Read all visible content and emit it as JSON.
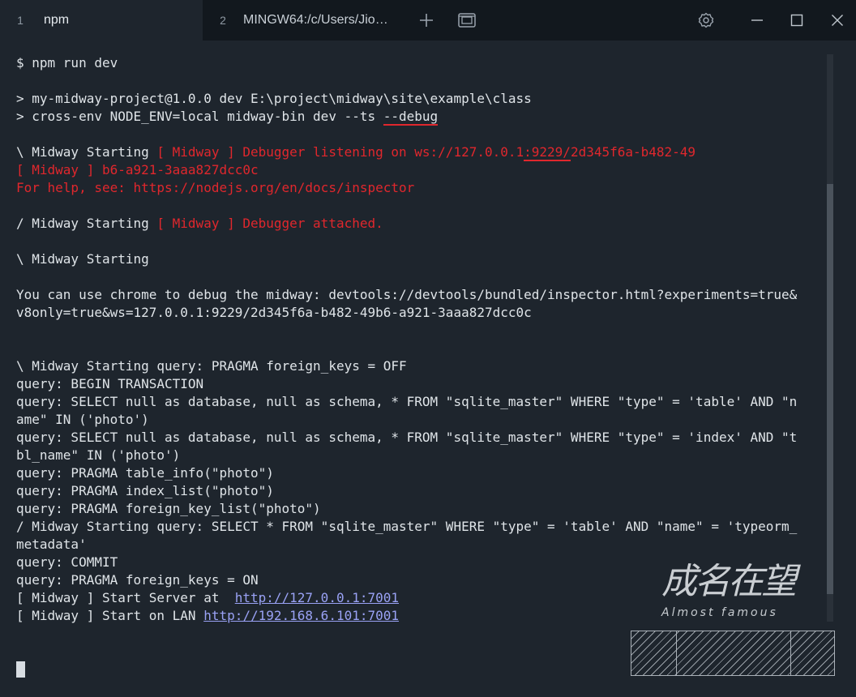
{
  "tabs": [
    {
      "num": "1",
      "label": "npm"
    },
    {
      "num": "2",
      "label": "MINGW64:/c/Users/Jio…"
    }
  ],
  "icons": {
    "add_tab": "plus-icon",
    "panes": "panes-icon",
    "settings": "gear-icon",
    "minimize": "minimize-icon",
    "maximize": "maximize-icon",
    "close": "close-icon"
  },
  "colors": {
    "error": "#e0272d",
    "link": "#9aa2f5",
    "text": "#dfe4e8",
    "background": "#1e252d"
  },
  "terminal": {
    "l0": "$ npm run dev",
    "l2": "> my-midway-project@1.0.0 dev E:\\project\\midway\\site\\example\\class",
    "l3a": "> cross-env NODE_ENV=local midway-bin dev --ts ",
    "l3b": "--debug",
    "l5a": "\\ Midway Starting ",
    "l5b": "[ Midway ] Debugger listening on ws://127.0.0.1",
    "l5c": ":9229/",
    "l5d": "2d345f6a-b482-49",
    "l6": "[ Midway ] b6-a921-3aaa827dcc0c",
    "l7": "For help, see: https://nodejs.org/en/docs/inspector",
    "l9a": "/ Midway Starting ",
    "l9b": "[ Midway ] Debugger attached.",
    "l11": "\\ Midway Starting",
    "l13": "You can use chrome to debug the midway: devtools://devtools/bundled/inspector.html?experiments=true&",
    "l14": "v8only=true&ws=127.0.0.1:9229/2d345f6a-b482-49b6-a921-3aaa827dcc0c",
    "l17": "\\ Midway Starting query: PRAGMA foreign_keys = OFF",
    "l18": "query: BEGIN TRANSACTION",
    "l19": "query: SELECT null as database, null as schema, * FROM \"sqlite_master\" WHERE \"type\" = 'table' AND \"n",
    "l20": "ame\" IN ('photo')",
    "l21": "query: SELECT null as database, null as schema, * FROM \"sqlite_master\" WHERE \"type\" = 'index' AND \"t",
    "l22": "bl_name\" IN ('photo')",
    "l23": "query: PRAGMA table_info(\"photo\")",
    "l24": "query: PRAGMA index_list(\"photo\")",
    "l25": "query: PRAGMA foreign_key_list(\"photo\")",
    "l26": "/ Midway Starting query: SELECT * FROM \"sqlite_master\" WHERE \"type\" = 'table' AND \"name\" = 'typeorm_",
    "l27": "metadata'",
    "l28": "query: COMMIT",
    "l29": "query: PRAGMA foreign_keys = ON",
    "l30a": "[ Midway ] Start Server at  ",
    "l30b": "http://127.0.0.1:7001",
    "l31a": "[ Midway ] Start on LAN ",
    "l31b": "http://192.168.6.101:7001"
  },
  "watermark": {
    "main": "成名在望",
    "sub": "Almost famous"
  }
}
